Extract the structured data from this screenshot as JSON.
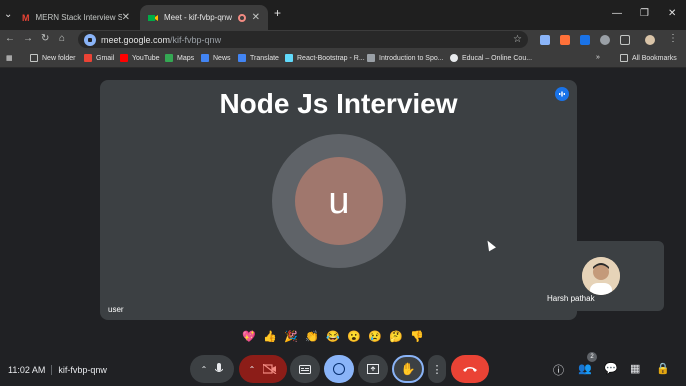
{
  "browser": {
    "tabs": [
      {
        "title": "MERN Stack Interview Schedulin"
      },
      {
        "title": "Meet - kif-fvbp-qnw"
      }
    ],
    "new_tab_symbol": "+",
    "url_host": "meet.google.com",
    "url_path": "/kif-fvbp-qnw"
  },
  "bookmarks": {
    "items": [
      {
        "label": "New folder",
        "icon": "folder-icon"
      },
      {
        "label": "Gmail",
        "icon": "gmail-icon"
      },
      {
        "label": "YouTube",
        "icon": "youtube-icon"
      },
      {
        "label": "Maps",
        "icon": "maps-icon"
      },
      {
        "label": "News",
        "icon": "news-icon"
      },
      {
        "label": "Translate",
        "icon": "translate-icon"
      },
      {
        "label": "React-Bootstrap - R...",
        "icon": "react-bootstrap-icon"
      },
      {
        "label": "Introduction to Spo...",
        "icon": "spotify-icon"
      },
      {
        "label": "Educal – Online Cou...",
        "icon": "educal-icon"
      }
    ],
    "all_bookmarks": "All Bookmarks"
  },
  "meeting": {
    "stage_title": "Node Js Interview",
    "participant_initial": "u",
    "participant_name": "user",
    "self_name": "Harsh pathak",
    "time": "11:02 AM",
    "meeting_code": "kif-fvbp-qnw",
    "people_count": "2",
    "reactions": [
      "💖",
      "👍",
      "🎉",
      "👏",
      "😂",
      "😮",
      "😢",
      "🤔",
      "👎"
    ]
  },
  "colors": {
    "end_call": "#ea4335",
    "mic_off_bg": "#8c1d18",
    "emoji_active": "#8ab4f8",
    "stage_bg": "#3c4043",
    "avatar_bg": "#a0776d"
  }
}
